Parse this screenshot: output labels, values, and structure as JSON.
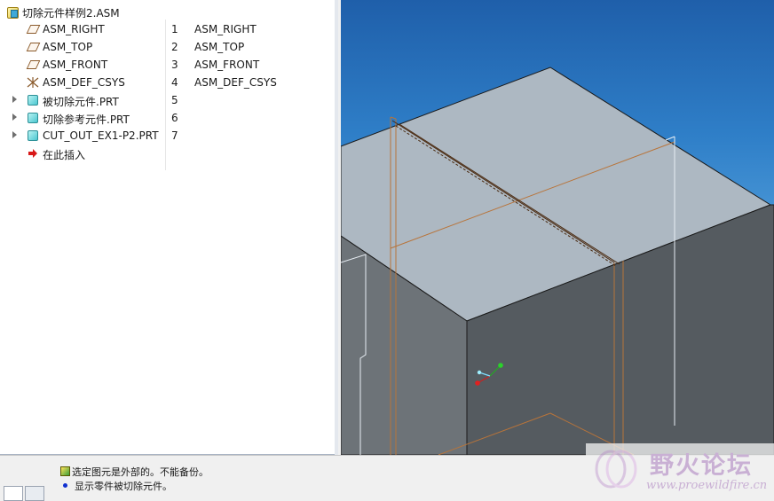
{
  "tree": {
    "root": {
      "label": "切除元件样例2.ASM",
      "icon": "assembly-icon"
    },
    "rows": [
      {
        "name": "ASM_RIGHT",
        "num": "1",
        "extra": "ASM_RIGHT",
        "icon": "datum-plane-icon"
      },
      {
        "name": "ASM_TOP",
        "num": "2",
        "extra": "ASM_TOP",
        "icon": "datum-plane-icon"
      },
      {
        "name": "ASM_FRONT",
        "num": "3",
        "extra": "ASM_FRONT",
        "icon": "datum-plane-icon"
      },
      {
        "name": "ASM_DEF_CSYS",
        "num": "4",
        "extra": "ASM_DEF_CSYS",
        "icon": "coordinate-system-icon"
      },
      {
        "name": "被切除元件.PRT",
        "num": "5",
        "extra": "",
        "icon": "part-icon",
        "expandable": true
      },
      {
        "name": "切除参考元件.PRT",
        "num": "6",
        "extra": "",
        "icon": "part-icon",
        "expandable": true
      },
      {
        "name": "CUT_OUT_EX1-P2.PRT",
        "num": "7",
        "extra": "",
        "icon": "part-icon",
        "expandable": true
      },
      {
        "name": "在此插入",
        "num": "",
        "extra": "",
        "icon": "insert-here-arrow-icon"
      }
    ]
  },
  "messages": [
    {
      "text": "选定图元是外部的。不能备份。",
      "icon": "warning-icon"
    },
    {
      "text": "显示零件被切除元件。",
      "icon": "info-bullet-icon"
    }
  ],
  "watermark": {
    "title": "野火论坛",
    "url": "www.proewildfire.cn"
  },
  "colors": {
    "top_face": "#adb8c2",
    "left_face": "#6d7378",
    "right_face": "#555b60",
    "edge_orange": "#b8743a"
  }
}
